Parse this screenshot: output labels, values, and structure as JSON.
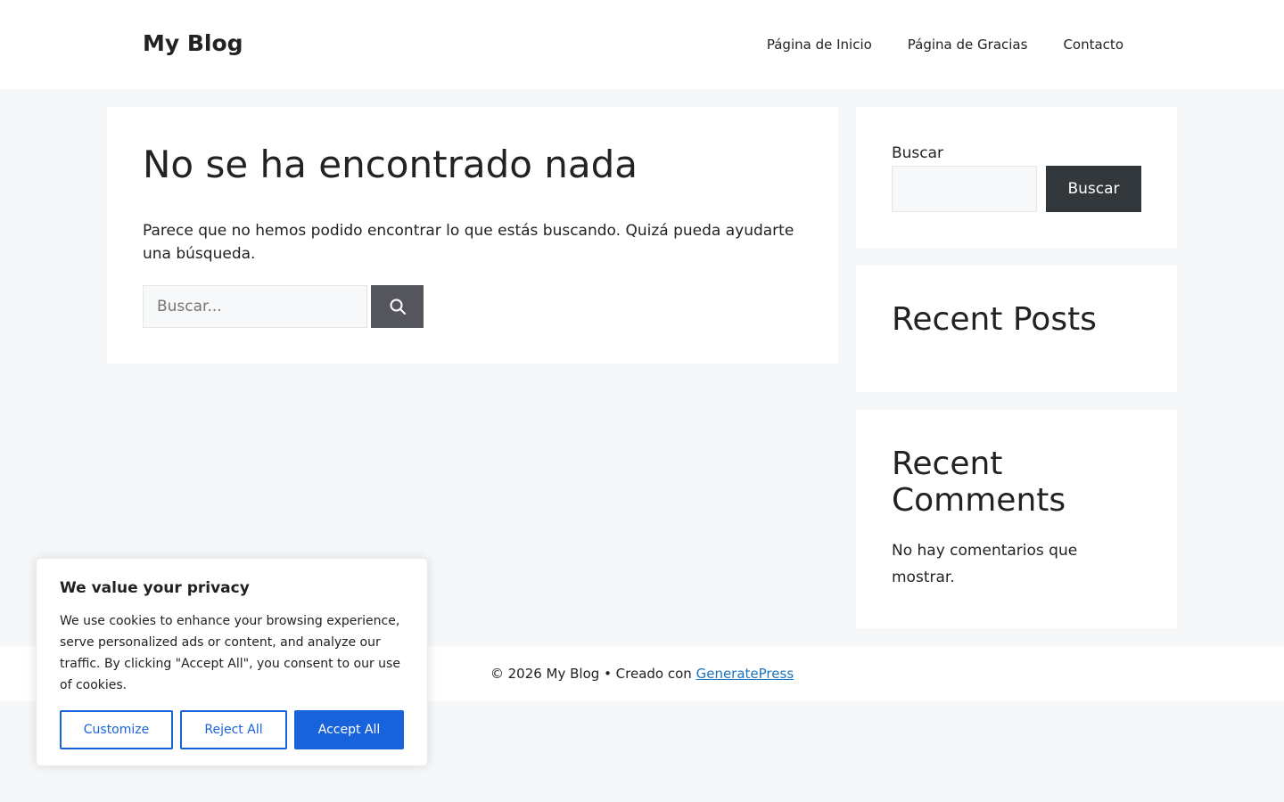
{
  "header": {
    "site_title": "My Blog",
    "nav": [
      "Página de Inicio",
      "Página de Gracias",
      "Contacto"
    ]
  },
  "main": {
    "title": "No se ha encontrado nada",
    "text": "Parece que no hemos podido encontrar lo que estás buscando. Quizá pueda ayudarte una búsqueda.",
    "search_placeholder": "Buscar...",
    "search_icon": "search-icon"
  },
  "sidebar": {
    "search_label": "Buscar",
    "search_button": "Buscar",
    "recent_posts_title": "Recent Posts",
    "recent_comments_title": "Recent Comments",
    "recent_comments_text": "No hay comentarios que mostrar."
  },
  "footer": {
    "text": "© 2026 My Blog • Creado con ",
    "link": "GeneratePress"
  },
  "cookie": {
    "title": "We value your privacy",
    "text": "We use cookies to enhance your browsing experience, serve personalized ads or content, and analyze our traffic. By clicking \"Accept All\", you consent to our use of cookies.",
    "customize": "Customize",
    "reject": "Reject All",
    "accept": "Accept All",
    "accent_color": "#1863dc"
  }
}
